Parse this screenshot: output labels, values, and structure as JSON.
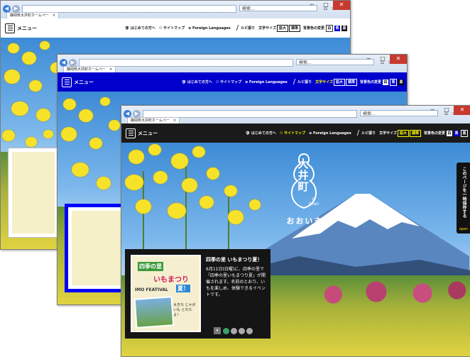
{
  "browser": {
    "tab_title": "静岡県大井町ホームペー",
    "search_placeholder": "検索...",
    "window_controls": {
      "minimize": "─",
      "maximize": "□",
      "close": "✕"
    },
    "toolbar_icons": [
      "home-icon",
      "star-icon",
      "gear-icon"
    ]
  },
  "site": {
    "menu_label": "メニュー",
    "links": {
      "beginners": "はじめての方へ",
      "sitemap": "サイトマップ",
      "foreign": "Foreign Languages"
    },
    "ruby": "ルビ振り",
    "font_size_label": "文字サイズ",
    "font_size_enlarge": "拡大",
    "font_size_standard": "標準",
    "bg_color_label": "背景色の変更",
    "bg_options": [
      "白",
      "青",
      "黒"
    ]
  },
  "hero": {
    "logo_kanji": "大井町",
    "logo_en": "oi town",
    "logo_slogan": "おおい未来",
    "side_tab": "このページを一時保存する",
    "side_tab_open": "open"
  },
  "news": {
    "title": "四季の里 いもまつり夏！",
    "body": "6月11日(日曜)に、四季の里で「四季の里いもまつり夏」が開催されます。名前のとおり、いもを楽しめ、体験できるイベントです。",
    "poster_line1": "四季の里",
    "poster_line2": "いもまつり",
    "poster_en": "IMO FEATIVAL",
    "poster_badge": "夏！",
    "poster_note": "大きな じゃがいも とれたよ！",
    "pause": "⏸",
    "dots": 4,
    "active_dot": 0
  },
  "theme_colors": {
    "white_theme": "#ffffff",
    "blue_theme": "#0000cc",
    "black_theme": "#1a1a1a",
    "highlight_yellow": "#ffff00",
    "news_panel": "#151515"
  }
}
